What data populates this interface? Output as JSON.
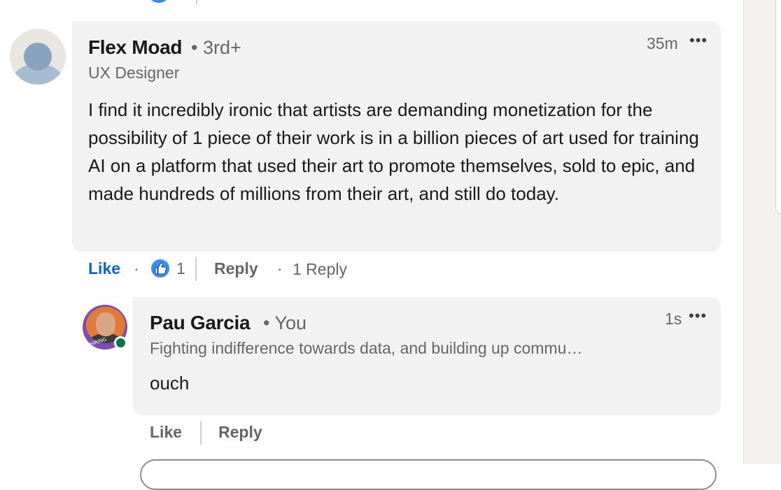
{
  "comment": {
    "author": "Flex Moad",
    "degree": "• 3rd+",
    "headline": "UX Designer",
    "time": "35m",
    "more": "•••",
    "text": "I find it incredibly ironic that artists are demanding monetization for the possibility of 1 piece of their work is in a billion pieces of art used for training AI on a platform that used their art to promote themselves, sold to epic, and made hundreds of millions from their art, and still do today.",
    "actions": {
      "like": "Like",
      "dot": "·",
      "reactions_count": "1",
      "reply": "Reply",
      "replies": "1 Reply"
    }
  },
  "reply": {
    "author": "Pau Garcia",
    "relation": "• You",
    "headline": "Fighting indifference towards data, and building up commu…",
    "time": "1s",
    "more": "•••",
    "text": "ouch",
    "actions": {
      "like": "Like",
      "reply": "Reply"
    },
    "avatar_badge": "#HIRING"
  },
  "colors": {
    "accent": "#0a66c2",
    "bubble": "#f2f2f2",
    "online": "#057642",
    "reaction": "#378fe9"
  }
}
